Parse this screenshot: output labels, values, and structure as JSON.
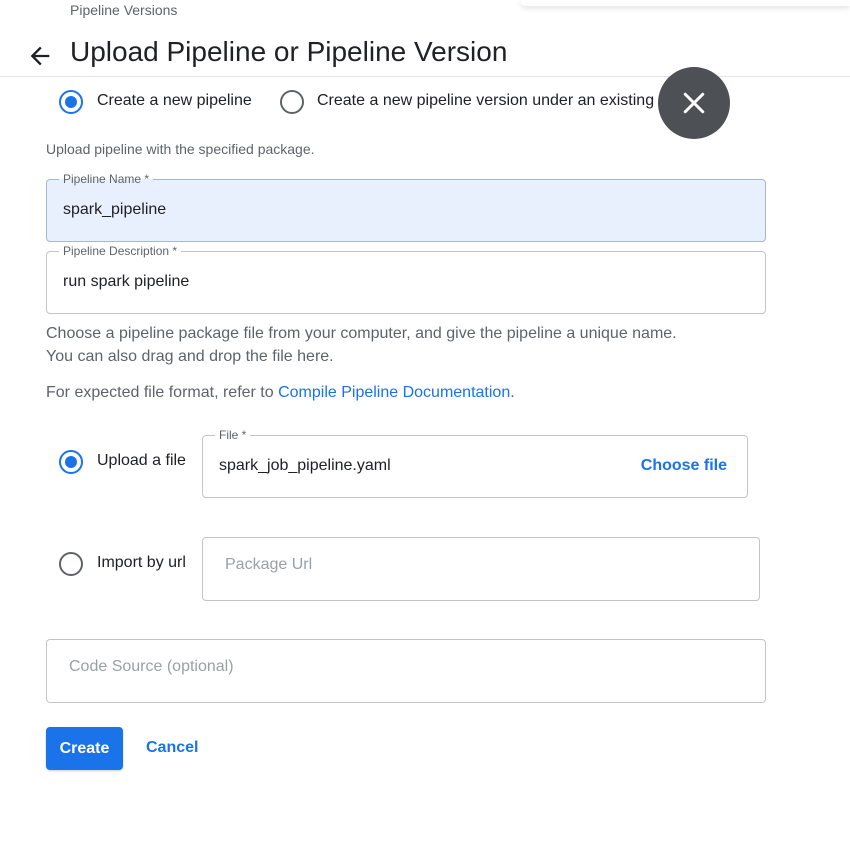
{
  "breadcrumb": "Pipeline Versions",
  "title": "Upload Pipeline or Pipeline Version",
  "mode_options": [
    {
      "label": "Create a new pipeline",
      "checked": true
    },
    {
      "label": "Create a new pipeline version under an existing pipeline",
      "checked": false
    }
  ],
  "upload_helper": "Upload pipeline with the specified package.",
  "pipeline_name": {
    "label": "Pipeline Name *",
    "value": "spark_pipeline"
  },
  "pipeline_description": {
    "label": "Pipeline Description *",
    "value": "run spark pipeline"
  },
  "instructions": {
    "line1": "Choose a pipeline package file from your computer, and give the pipeline a unique name.",
    "line2": "You can also drag and drop the file here.",
    "format_prefix": "For expected file format, refer to ",
    "format_link": "Compile Pipeline Documentation",
    "format_suffix": "."
  },
  "source_options": {
    "upload": {
      "label": "Upload a file",
      "checked": true
    },
    "url": {
      "label": "Import by url",
      "checked": false
    }
  },
  "file_field": {
    "label": "File *",
    "value": "spark_job_pipeline.yaml",
    "choose_label": "Choose file"
  },
  "package_url": {
    "placeholder": "Package Url"
  },
  "code_source": {
    "placeholder": "Code Source (optional)"
  },
  "actions": {
    "create": "Create",
    "cancel": "Cancel"
  },
  "colors": {
    "accent": "#1a73e8",
    "fab": "#4d5055",
    "filled_field": "#e8f0fe"
  },
  "icons": {
    "back": "arrow-left-icon",
    "close": "close-icon"
  }
}
